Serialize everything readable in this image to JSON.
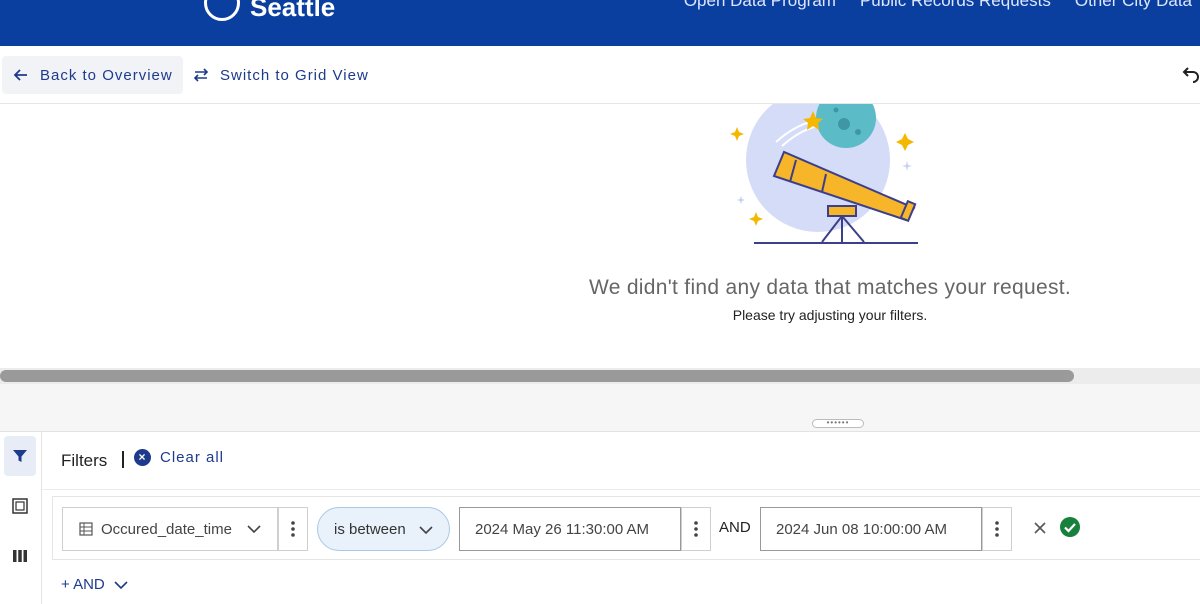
{
  "header": {
    "brand": "Seattle",
    "nav": [
      "Open Data Program",
      "Public Records Requests",
      "Other City Data"
    ]
  },
  "toolbar": {
    "back_label": "Back to Overview",
    "switch_label": "Switch to Grid View"
  },
  "empty_state": {
    "title": "We didn't find any data that matches your request.",
    "subtitle": "Please try adjusting your filters."
  },
  "filters": {
    "title": "Filters",
    "clear_all": "Clear all",
    "row": {
      "field": "Occured_date_time",
      "operator": "is between",
      "value_from": "2024 May 26 11:30:00 AM",
      "joiner": "AND",
      "value_to": "2024 Jun 08 10:00:00 AM"
    },
    "add_label": "+ AND"
  },
  "colors": {
    "header_bg": "#0a3fa0",
    "accent": "#1d3b8c",
    "success": "#17803d"
  }
}
